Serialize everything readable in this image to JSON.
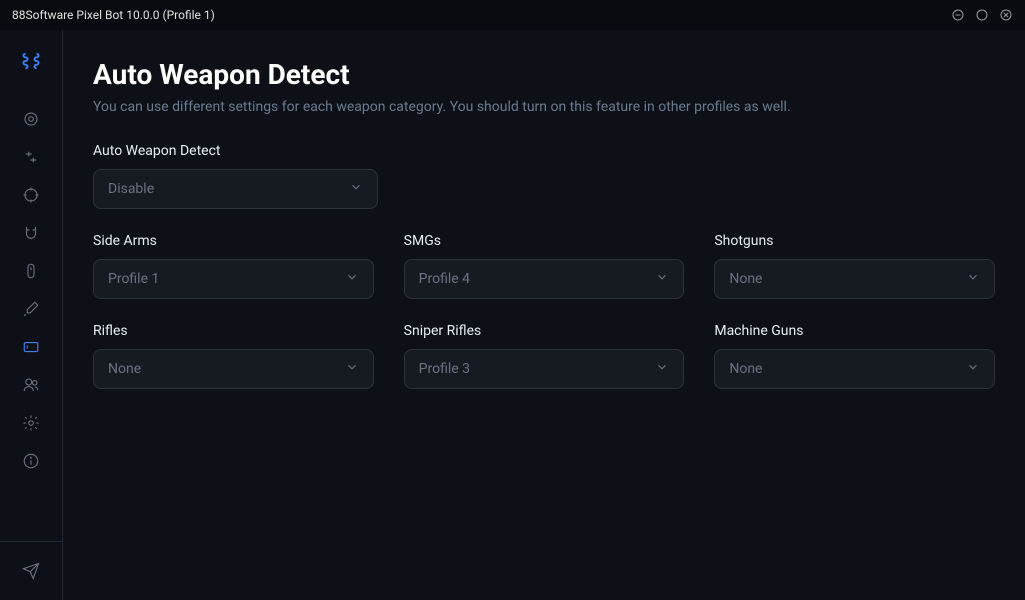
{
  "titlebar": {
    "title": "88Software Pixel Bot 10.0.0 (Profile 1)"
  },
  "page": {
    "title": "Auto Weapon Detect",
    "subtitle": "You can use different settings for each weapon category. You should turn on this feature in other profiles as well."
  },
  "main_setting": {
    "label": "Auto Weapon Detect",
    "value": "Disable"
  },
  "categories": {
    "side_arms": {
      "label": "Side Arms",
      "value": "Profile 1"
    },
    "smgs": {
      "label": "SMGs",
      "value": "Profile 4"
    },
    "shotguns": {
      "label": "Shotguns",
      "value": "None"
    },
    "rifles": {
      "label": "Rifles",
      "value": "None"
    },
    "sniper_rifles": {
      "label": "Sniper Rifles",
      "value": "Profile 3"
    },
    "machine_guns": {
      "label": "Machine Guns",
      "value": "None"
    }
  }
}
